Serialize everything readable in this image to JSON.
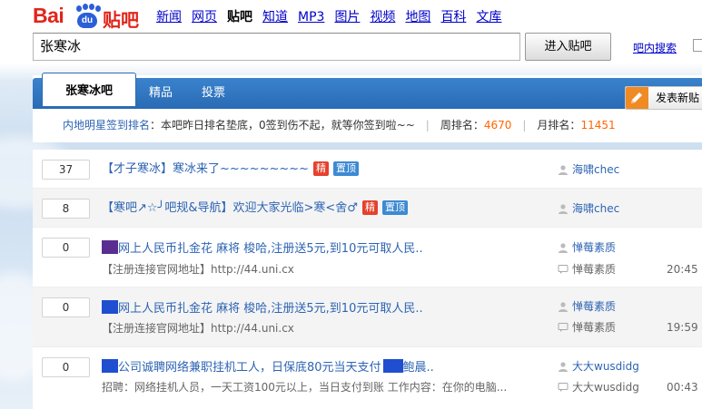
{
  "header": {
    "logo": {
      "bai": "Bai",
      "du": "du",
      "tieba": "贴吧"
    },
    "nav": [
      "新闻",
      "网页",
      "贴吧",
      "知道",
      "MP3",
      "图片",
      "视频",
      "地图",
      "百科",
      "文库"
    ],
    "search": {
      "value": "张寒冰",
      "button": "进入贴吧",
      "inbar_link": "吧内搜索"
    }
  },
  "forum": {
    "tabs": {
      "forum": "张寒冰吧",
      "elite": "精品",
      "vote": "投票"
    },
    "post_button": "发表新贴",
    "rank": {
      "label": "内地明星签到排名",
      "text": "：本吧昨日排名垫底，0签到伤不起，就等你签到啦~~",
      "week_label": "周排名：",
      "week_value": "4670",
      "month_label": "月排名：",
      "month_value": "11451"
    }
  },
  "threads": [
    {
      "count": "37",
      "title": "【才子寒冰】寒冰来了~~~~~~~~~",
      "badges": [
        "精",
        "置顶"
      ],
      "author": "海啸chec"
    },
    {
      "count": "8",
      "title": "【寒吧↗☆╯吧规&导航】欢迎大家光临>寒<舍♂",
      "badges": [
        "精",
        "置顶"
      ],
      "author": "海啸chec"
    },
    {
      "count": "0",
      "title": "网上人民币扎金花  麻将  梭哈,注册送5元,到10元可取人民..",
      "desc": "【注册连接官网地址】http://44.uni.cx",
      "author": "惮莓素质",
      "replier": "惮莓素质",
      "time": "20:45"
    },
    {
      "count": "0",
      "title": "网上人民币扎金花  麻将  梭哈,注册送5元,到10元可取人民..",
      "desc": "【注册连接官网地址】http://44.uni.cx",
      "author": "惮莓素质",
      "replier": "惮莓素质",
      "time": "19:59"
    },
    {
      "count": "0",
      "title": "公司诚聘网络兼职挂机工人，日保底80元当天支付",
      "title_tail": "鲍晨..",
      "desc": "招聘：网络挂机人员，一天工资100元以上，当日支付到账  工作内容：在你的电脑...",
      "author": "大大wusdidg",
      "replier": "大大wusdidg",
      "time": "00:43"
    }
  ],
  "colors": {
    "link": "#2d64b3",
    "tab_blue": "#2a6bb5",
    "accent_orange": "#ff6600",
    "logo_red": "#e1251b",
    "block_purple": "#5a2e91",
    "block_blue": "#1f4fd0"
  }
}
